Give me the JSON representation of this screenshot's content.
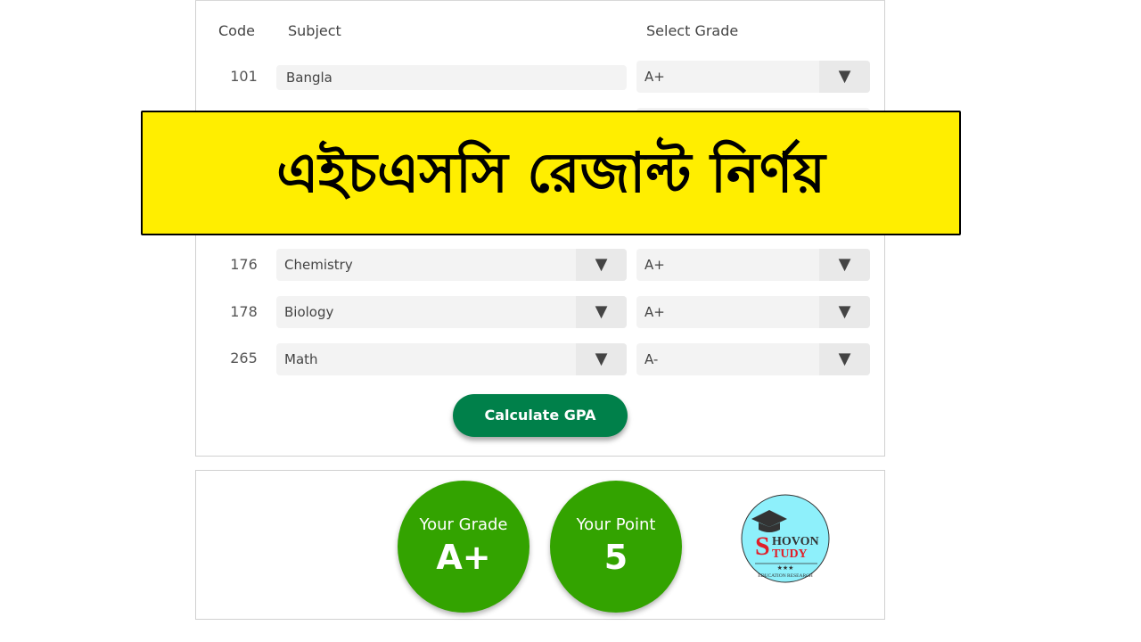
{
  "headers": {
    "code": "Code",
    "subject": "Subject",
    "grade": "Select Grade"
  },
  "rows": [
    {
      "code": "101",
      "subject": "Bangla",
      "grade": "A+",
      "subject_dropdown": false
    },
    {
      "code": "176",
      "subject": "Chemistry",
      "grade": "A+",
      "subject_dropdown": true
    },
    {
      "code": "178",
      "subject": "Biology",
      "grade": "A+",
      "subject_dropdown": true
    },
    {
      "code": "265",
      "subject": "Math",
      "grade": "A-",
      "subject_dropdown": true
    }
  ],
  "arrow_icon": "▼",
  "calculate_label": "Calculate GPA",
  "result": {
    "grade_label": "Your Grade",
    "grade_value": "A+",
    "point_label": "Your Point",
    "point_value": "5"
  },
  "banner_title": "এইচএসসি রেজাল্ট নির্ণয়",
  "logo": {
    "line1": "SHOVON",
    "line2": "STUDY",
    "tagline": "EDUCATION RESEARCH"
  },
  "colors": {
    "button": "#00804a",
    "circle": "#33a300",
    "banner": "#ffee00"
  }
}
